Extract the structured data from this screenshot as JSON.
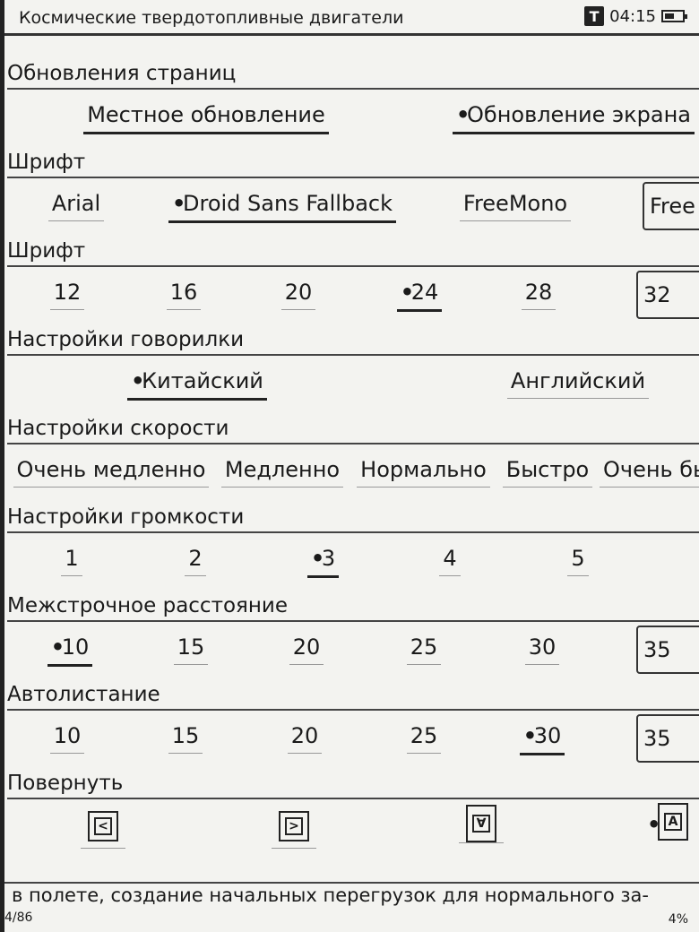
{
  "status": {
    "book_title": "Космические твердотопливные двигатели",
    "t_badge": "T",
    "time": "04:15"
  },
  "sections": [
    {
      "title": "Обновления страниц",
      "options": [
        {
          "label": "Местное обновление",
          "selected": false
        },
        {
          "label": "Обновление экрана",
          "selected": true
        }
      ]
    },
    {
      "title": "Шрифт",
      "options": [
        {
          "label": "Arial",
          "selected": false
        },
        {
          "label": "Droid Sans Fallback",
          "selected": true
        },
        {
          "label": "FreeMono",
          "selected": false
        },
        {
          "label": "Free",
          "selected": false
        }
      ]
    },
    {
      "title": "Шрифт",
      "options": [
        {
          "label": "12"
        },
        {
          "label": "16"
        },
        {
          "label": "20"
        },
        {
          "label": "24",
          "selected": true
        },
        {
          "label": "28"
        },
        {
          "label": "32"
        }
      ]
    },
    {
      "title": "Настройки говорилки",
      "options": [
        {
          "label": "Китайский",
          "selected": true
        },
        {
          "label": "Английский",
          "selected": false
        }
      ]
    },
    {
      "title": "Настройки скорости",
      "options": [
        {
          "label": "Очень медленно"
        },
        {
          "label": "Медленно"
        },
        {
          "label": "Нормально"
        },
        {
          "label": "Быстро"
        },
        {
          "label": "Очень бы"
        }
      ]
    },
    {
      "title": "Настройки громкости",
      "options": [
        {
          "label": "1"
        },
        {
          "label": "2"
        },
        {
          "label": "3",
          "selected": true
        },
        {
          "label": "4"
        },
        {
          "label": "5"
        }
      ]
    },
    {
      "title": "Межстрочное расстояние",
      "options": [
        {
          "label": "10",
          "selected": true
        },
        {
          "label": "15"
        },
        {
          "label": "20"
        },
        {
          "label": "25"
        },
        {
          "label": "30"
        },
        {
          "label": "35"
        }
      ]
    },
    {
      "title": "Автолистание",
      "options": [
        {
          "label": "10"
        },
        {
          "label": "15"
        },
        {
          "label": "20"
        },
        {
          "label": "25"
        },
        {
          "label": "30",
          "selected": true
        },
        {
          "label": "35"
        }
      ]
    },
    {
      "title": "Повернуть",
      "options": [
        {
          "icon": "rotate-left-icon",
          "glyph": "<"
        },
        {
          "icon": "rotate-right-icon",
          "glyph": ">"
        },
        {
          "icon": "rotate-180-icon",
          "glyph": "∀"
        },
        {
          "icon": "rotate-normal-icon",
          "glyph": "A",
          "selected": true
        }
      ]
    }
  ],
  "page": {
    "text": "в полете, создание начальных перегрузок для нормального за-",
    "page_number": "4/86",
    "progress": "4%"
  }
}
